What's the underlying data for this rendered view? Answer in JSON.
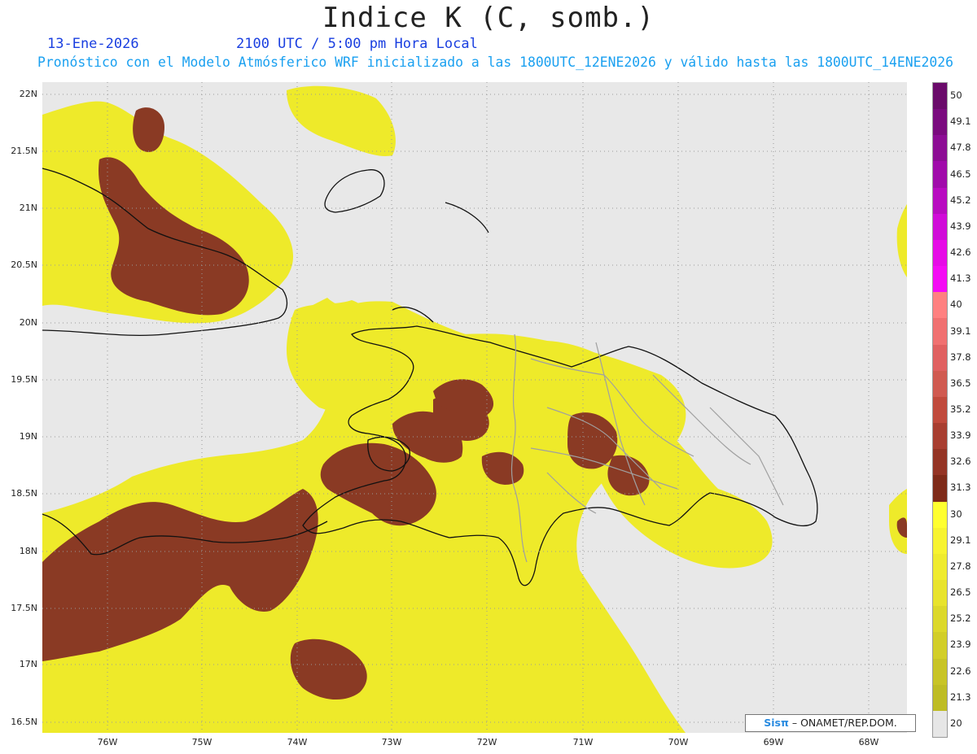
{
  "header": {
    "title": "Indice K (C, somb.)",
    "date": "13-Ene-2026",
    "time": "2100 UTC / 5:00 pm Hora Local",
    "forecast": "Pronóstico con el Modelo Atmósferico WRF inicializado a las 1800UTC_12ENE2026 y válido hasta las  1800UTC_14ENE2026"
  },
  "axes": {
    "lat_labels": [
      "22N",
      "21.5N",
      "21N",
      "20.5N",
      "20N",
      "19.5N",
      "19N",
      "18.5N",
      "18N",
      "17.5N",
      "17N",
      "16.5N"
    ],
    "lon_labels": [
      "76W",
      "75W",
      "74W",
      "73W",
      "72W",
      "71W",
      "70W",
      "69W",
      "68W"
    ]
  },
  "colorbar": {
    "labels": [
      "50",
      "49.1",
      "47.8",
      "46.5",
      "45.2",
      "43.9",
      "42.6",
      "41.3",
      "40",
      "39.1",
      "37.8",
      "36.5",
      "35.2",
      "33.9",
      "32.6",
      "31.3",
      "30",
      "29.1",
      "27.8",
      "26.5",
      "25.2",
      "23.9",
      "22.6",
      "21.3",
      "20"
    ],
    "colors": [
      "#6a0a6a",
      "#7a0a7e",
      "#8c0c94",
      "#a00aaa",
      "#b80ac0",
      "#d00ad8",
      "#e60ae6",
      "#f40af4",
      "#ff8080",
      "#f07070",
      "#e06060",
      "#d05a50",
      "#c04a3c",
      "#a83e30",
      "#943424",
      "#7e2a18",
      "#ffff30",
      "#f7f330",
      "#efeb2e",
      "#e8e32c",
      "#dcd82a",
      "#d2ce28",
      "#c8c426",
      "#bebc24",
      "#e6e6e6"
    ]
  },
  "legend_colors": {
    "background": "#e8e8e8",
    "yellow": "#eeea2a",
    "brown": "#8a3a24",
    "coast": "#111111",
    "border": "#a0a0a0"
  },
  "credit": {
    "logo": "Sisπ",
    "org": "– ONAMET/REP.DOM."
  }
}
